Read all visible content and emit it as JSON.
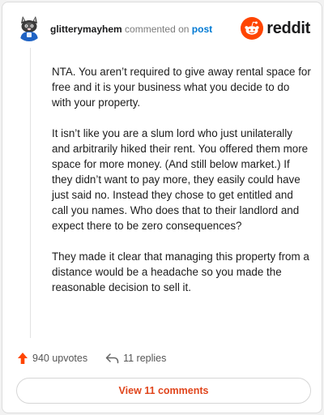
{
  "header": {
    "username": "glitterymayhem",
    "action_text": "commented on",
    "post_link": "post",
    "brand": "reddit"
  },
  "comment": {
    "paragraphs": [
      "NTA. You aren’t required to give away rental space for free and it is your business what you decide to do with your property.",
      "It isn’t like you are a slum lord who just unilaterally and arbitrarily hiked their rent. You offered them more space for more money. (And still below market.) If they didn’t want to pay more, they easily could have just said no. Instead they chose to get entitled and call you names. Who does that to their landlord and expect there to be zero consequences?",
      "They made it clear that managing this property from a distance would be a headache so you made the reasonable decision to sell it."
    ]
  },
  "actions": {
    "upvotes": "940 upvotes",
    "replies": "11 replies",
    "view_comments": "View 11 comments"
  },
  "colors": {
    "brand_orange": "#ff4500",
    "link_blue": "#0079d3",
    "button_text": "#e0451c"
  },
  "icons": {
    "avatar": "snoo-avatar-icon",
    "brand_logo": "reddit-logo-icon",
    "upvote": "upvote-arrow-icon",
    "reply": "reply-arrow-icon"
  }
}
